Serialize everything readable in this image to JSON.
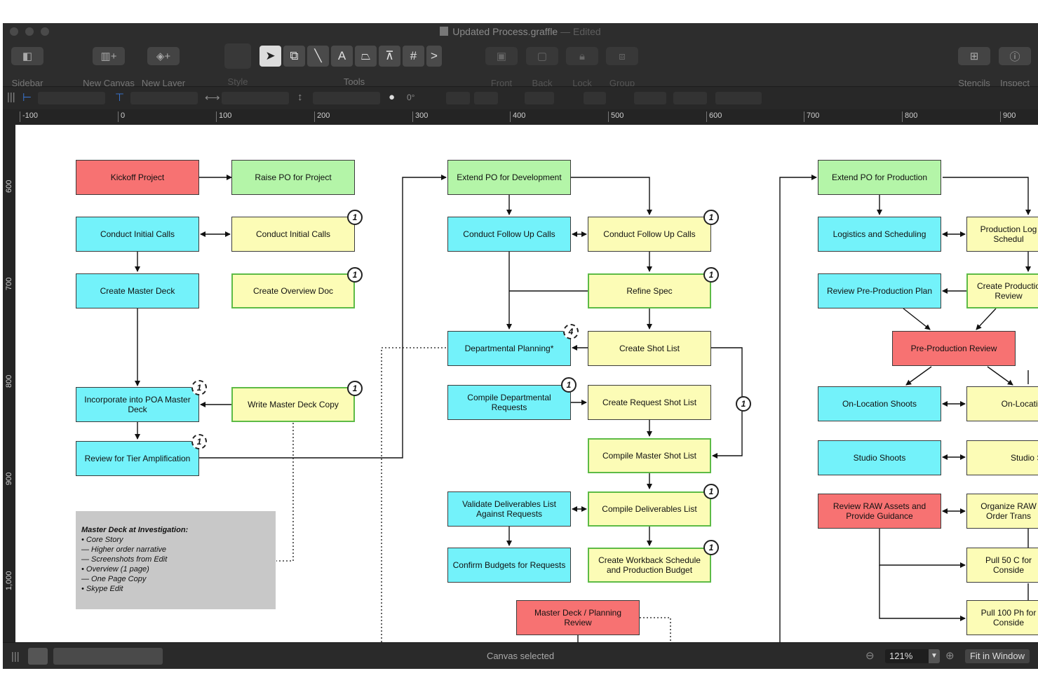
{
  "window": {
    "title": "Updated Process.graffle",
    "edited": "— Edited"
  },
  "toolbar": {
    "sidebar": "Sidebar",
    "new_canvas": "New Canvas",
    "new_layer": "New Layer",
    "style": "Style",
    "tools": "Tools",
    "front": "Front",
    "back": "Back",
    "lock": "Lock",
    "group": "Group",
    "stencils": "Stencils",
    "inspect": "Inspect",
    "tool_text_glyph": "A",
    "tool_grid_glyph": "#",
    "tool_more_glyph": ">"
  },
  "inspector": {
    "rotation": "0°"
  },
  "ruler": {
    "horizontal": [
      "-100",
      "0",
      "100",
      "200",
      "300",
      "400",
      "500",
      "600",
      "700",
      "800",
      "900"
    ],
    "vertical": [
      "600",
      "700",
      "800",
      "900",
      "1,000"
    ]
  },
  "nodes": {
    "kickoff": "Kickoff Project",
    "raise_po": "Raise PO for Project",
    "conduct_initial_left": "Conduct Initial Calls",
    "conduct_initial_right": "Conduct Initial Calls",
    "create_master_deck": "Create Master Deck",
    "create_overview_doc": "Create Overview Doc",
    "incorporate_poa": "Incorporate into POA Master Deck",
    "write_master_deck": "Write Master Deck Copy",
    "review_tier": "Review for Tier Amplification",
    "extend_po_dev": "Extend PO for Development",
    "followup_left": "Conduct Follow Up Calls",
    "followup_right": "Conduct Follow Up Calls",
    "refine_spec": "Refine Spec",
    "dept_planning": "Departmental Planning*",
    "create_shot_list": "Create Shot List",
    "compile_dept": "Compile Departmental Requests",
    "create_request_shot": "Create Request Shot List",
    "compile_master_shot": "Compile Master Shot List",
    "validate_deliverables": "Validate Deliverables List Against Requests",
    "compile_deliverables": "Compile Deliverables List",
    "confirm_budgets": "Confirm Budgets for Requests",
    "create_workback": "Create Workback Schedule and Production Budget",
    "master_deck_review": "Master Deck / Planning Review",
    "extend_po_prod": "Extend PO for Production",
    "logistics": "Logistics and Scheduling",
    "production_log": "Production Log Schedul",
    "review_preprod": "Review Pre-Production Plan",
    "create_production": "Create Productio Review",
    "preprod_review": "Pre-Production Review",
    "onlocation_left": "On-Location Shoots",
    "onlocation_right": "On-Location",
    "studio_left": "Studio Shoots",
    "studio_right": "Studio Sh",
    "review_raw": "Review RAW Assets and Provide Guidance",
    "organize_raw": "Organize RAW Order Trans",
    "pull_50": "Pull 50 C for Conside",
    "pull_100": "Pull 100 Ph for Conside"
  },
  "badges": {
    "b1": "1",
    "b2": "1",
    "b3": "1",
    "b4": "1",
    "b5": "1",
    "b6": "1",
    "b7": "1",
    "b8": "1",
    "b9": "4",
    "b10": "1",
    "b11": "1",
    "b12": "1",
    "b13": "1"
  },
  "note": {
    "title": "Master Deck at Investigation:",
    "lines": [
      "• Core Story",
      "— Higher order narrative",
      "— Screenshots from Edit",
      "• Overview (1 page)",
      "— One Page Copy",
      "• Skype Edit"
    ]
  },
  "status": {
    "text": "Canvas selected",
    "zoom": "121%",
    "fit": "Fit in Window"
  },
  "colors": {
    "green": "#b4f5a8",
    "cyan": "#73f2fa",
    "yellow": "#fcfcb6",
    "red": "#f77272",
    "note_gray": "#c8c8c8",
    "green_border": "#5dbb46"
  }
}
